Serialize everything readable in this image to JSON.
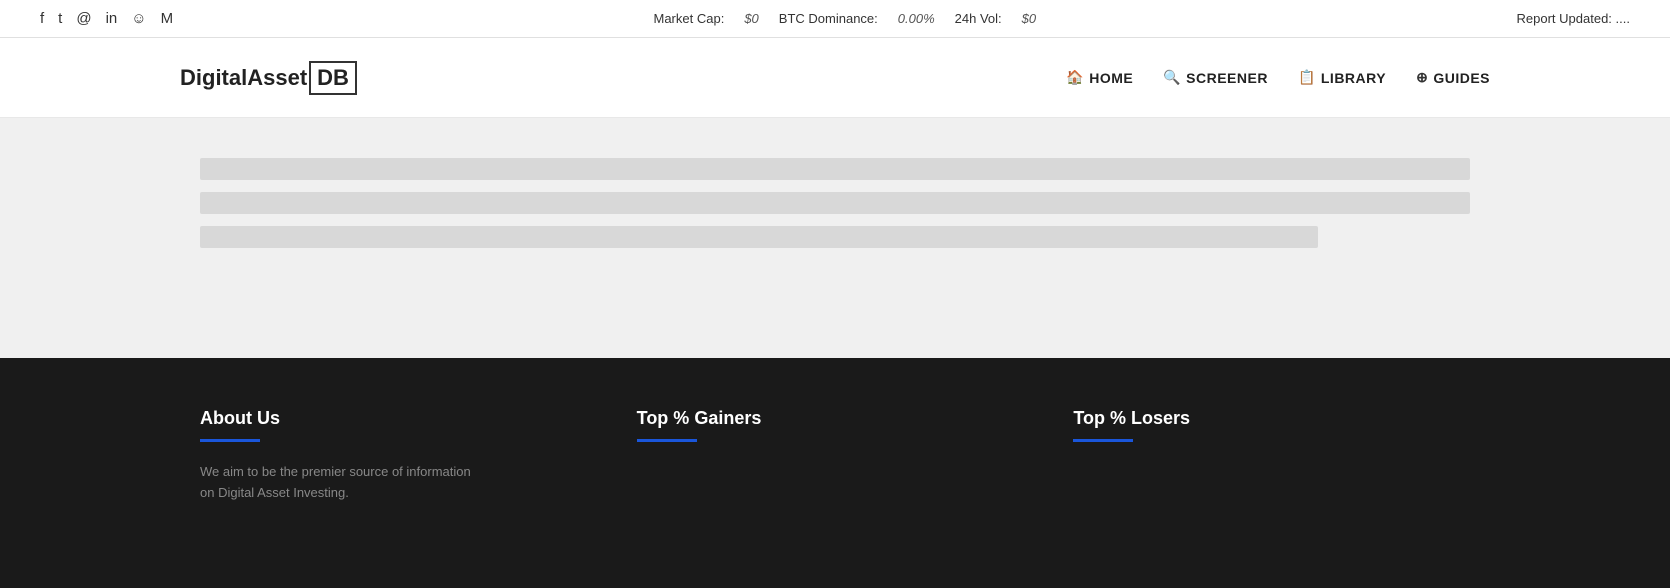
{
  "topbar": {
    "market_cap_label": "Market Cap:",
    "market_cap_value": "$0",
    "btc_dominance_label": "BTC Dominance:",
    "btc_dominance_value": "0.00%",
    "vol_label": "24h Vol:",
    "vol_value": "$0",
    "report_label": "Report Updated:",
    "report_value": "...."
  },
  "social": {
    "icons": [
      "f",
      "𝕋",
      "📷",
      "in",
      "👽",
      "M"
    ]
  },
  "nav": {
    "logo_prefix": "DigitalAsset",
    "logo_suffix": "DB",
    "items": [
      {
        "icon": "🏠",
        "label": "HOME"
      },
      {
        "icon": "🔍",
        "label": "SCREENER"
      },
      {
        "icon": "📋",
        "label": "LIBRARY"
      },
      {
        "icon": "⊕",
        "label": "GUIDES"
      }
    ]
  },
  "footer": {
    "about": {
      "title": "About Us",
      "text": "We aim to be the premier source of information on Digital Asset Investing."
    },
    "gainers": {
      "title": "Top % Gainers"
    },
    "losers": {
      "title": "Top % Losers"
    }
  }
}
